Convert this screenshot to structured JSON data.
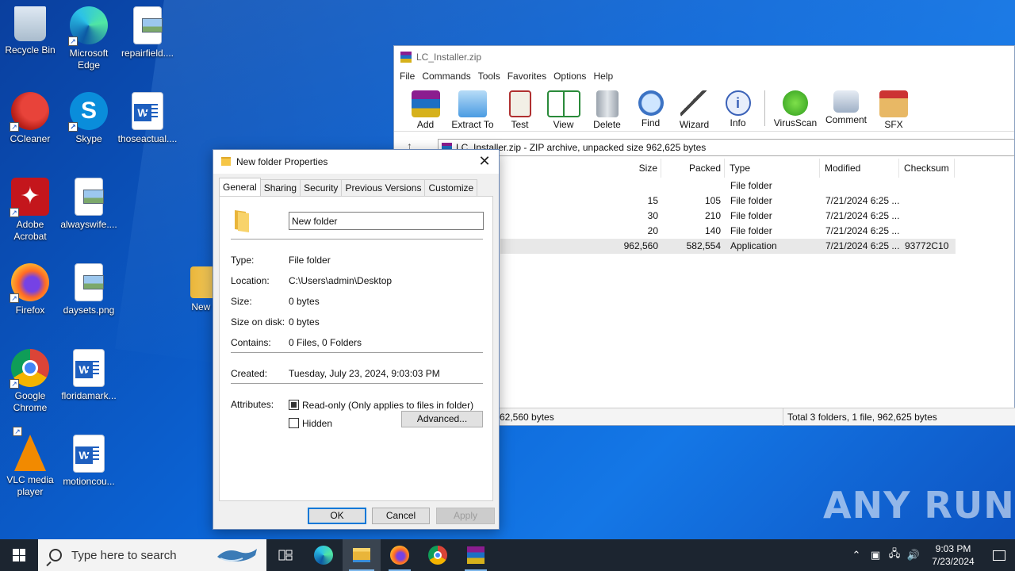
{
  "desktop": {
    "icons": [
      {
        "label": "Recycle Bin"
      },
      {
        "label": "Microsoft Edge"
      },
      {
        "label": "repairfield...."
      },
      {
        "label": "CCleaner"
      },
      {
        "label": "Skype"
      },
      {
        "label": "thoseactual...."
      },
      {
        "label": "Adobe Acrobat"
      },
      {
        "label": "alwayswife...."
      },
      {
        "label": "Firefox"
      },
      {
        "label": "daysets.png"
      },
      {
        "label": "New fo"
      },
      {
        "label": "Google Chrome"
      },
      {
        "label": "floridamark..."
      },
      {
        "label": "VLC media player"
      },
      {
        "label": "motioncou..."
      }
    ],
    "watermark": "ANY RUN"
  },
  "winrar": {
    "title": "LC_Installer.zip",
    "menu": [
      "File",
      "Commands",
      "Tools",
      "Favorites",
      "Options",
      "Help"
    ],
    "toolbar": [
      "Add",
      "Extract To",
      "Test",
      "View",
      "Delete",
      "Find",
      "Wizard",
      "Info",
      "VirusScan",
      "Comment",
      "SFX"
    ],
    "address": "LC_Installer.zip - ZIP archive, unpacked size 962,625 bytes",
    "columns": [
      "Size",
      "Packed",
      "Type",
      "Modified",
      "Checksum"
    ],
    "rows": [
      {
        "size": "",
        "packed": "",
        "type": "File folder",
        "modified": "",
        "checksum": ""
      },
      {
        "size": "15",
        "packed": "105",
        "type": "File folder",
        "modified": "7/21/2024 6:25 ...",
        "checksum": ""
      },
      {
        "size": "30",
        "packed": "210",
        "type": "File folder",
        "modified": "7/21/2024 6:25 ...",
        "checksum": ""
      },
      {
        "size": "20",
        "packed": "140",
        "type": "File folder",
        "modified": "7/21/2024 6:25 ...",
        "checksum": ""
      },
      {
        "size": "962,560",
        "packed": "582,554",
        "type": "Application",
        "modified": "7/21/2024 6:25 ...",
        "checksum": "93772C10"
      }
    ],
    "status_left": "62,560 bytes",
    "status_right": "Total 3 folders, 1 file, 962,625 bytes"
  },
  "dialog": {
    "title": "New folder Properties",
    "tabs": [
      "General",
      "Sharing",
      "Security",
      "Previous Versions",
      "Customize"
    ],
    "name_value": "New folder",
    "fields": [
      {
        "label": "Type:",
        "value": "File folder"
      },
      {
        "label": "Location:",
        "value": "C:\\Users\\admin\\Desktop"
      },
      {
        "label": "Size:",
        "value": "0 bytes"
      },
      {
        "label": "Size on disk:",
        "value": "0 bytes"
      },
      {
        "label": "Contains:",
        "value": "0 Files, 0 Folders"
      }
    ],
    "created_label": "Created:",
    "created_value": "Tuesday, July 23, 2024, 9:03:03 PM",
    "attributes_label": "Attributes:",
    "readonly_label": "Read-only (Only applies to files in folder)",
    "hidden_label": "Hidden",
    "advanced_label": "Advanced...",
    "ok_label": "OK",
    "cancel_label": "Cancel",
    "apply_label": "Apply"
  },
  "taskbar": {
    "search_placeholder": "Type here to search",
    "time": "9:03 PM",
    "date": "7/23/2024"
  }
}
